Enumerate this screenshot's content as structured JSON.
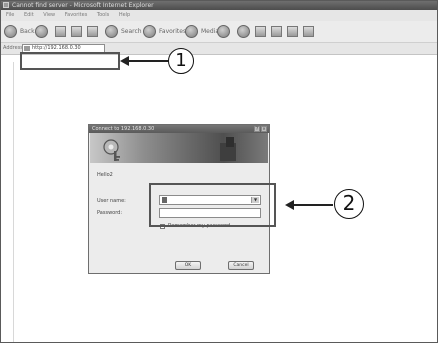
{
  "window": {
    "title": "Cannot find server - Microsoft Internet Explorer"
  },
  "menu": [
    "File",
    "Edit",
    "View",
    "Favorites",
    "Tools",
    "Help"
  ],
  "toolbar": {
    "back": "Back",
    "search": "Search",
    "favorites": "Favorites",
    "media": "Media"
  },
  "address": {
    "label": "Address",
    "url": "http://192.168.0.30"
  },
  "dialog": {
    "title": "Connect to 192.168.0.30",
    "message": "Hello2",
    "username_label": "User name:",
    "password_label": "Password:",
    "remember_label": "Remember my password",
    "ok_label": "OK",
    "cancel_label": "Cancel"
  },
  "callouts": {
    "one": "1",
    "two": "2"
  }
}
